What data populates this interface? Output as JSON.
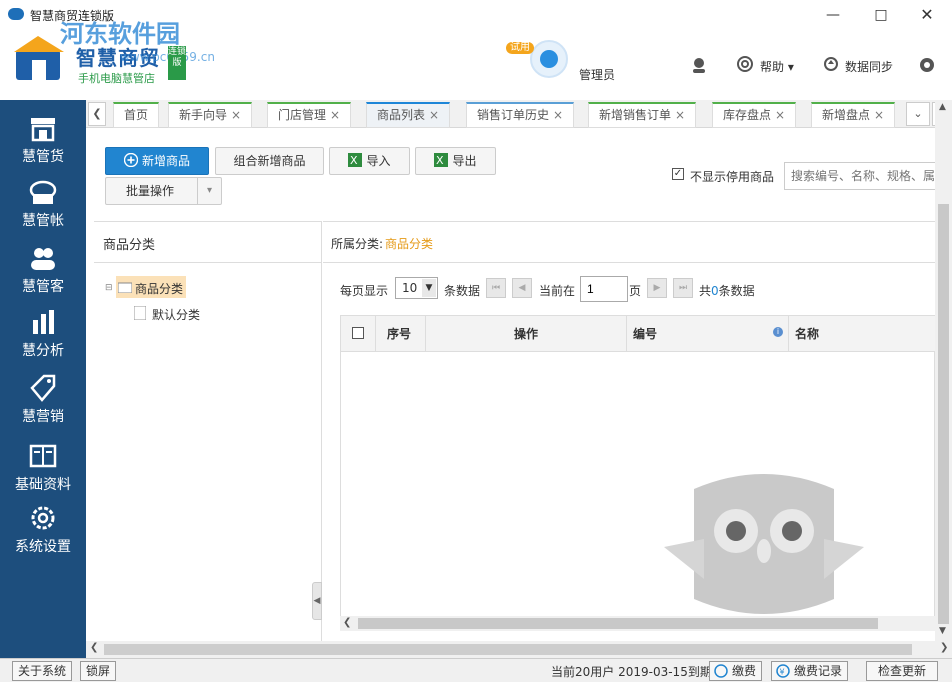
{
  "window": {
    "title": "智慧商贸连锁版"
  },
  "brand": {
    "name": "智慧商贸",
    "tagline": "手机电脑慧管店",
    "badge": "连锁版",
    "watermark": "河东软件园",
    "watermark_url": "www.pc0359.cn"
  },
  "header": {
    "trial_badge": "试用",
    "user": "管理员",
    "help": "帮助",
    "sync": "数据同步"
  },
  "sidebar": {
    "items": [
      {
        "label": "慧管货",
        "icon": "store-icon"
      },
      {
        "label": "慧管帐",
        "icon": "ledger-icon"
      },
      {
        "label": "慧管客",
        "icon": "customers-icon"
      },
      {
        "label": "慧分析",
        "icon": "bar-chart-icon"
      },
      {
        "label": "慧营销",
        "icon": "tag-icon"
      },
      {
        "label": "基础资料",
        "icon": "book-icon"
      },
      {
        "label": "系统设置",
        "icon": "gear-icon"
      }
    ]
  },
  "tabs": [
    {
      "label": "首页",
      "closable": false
    },
    {
      "label": "新手向导",
      "closable": true
    },
    {
      "label": "门店管理",
      "closable": true
    },
    {
      "label": "商品列表",
      "closable": true
    },
    {
      "label": "销售订单历史",
      "closable": true
    },
    {
      "label": "新增销售订单",
      "closable": true
    },
    {
      "label": "库存盘点",
      "closable": true
    },
    {
      "label": "新增盘点",
      "closable": true
    }
  ],
  "toolbar": {
    "add": "新增商品",
    "combo_add": "组合新增商品",
    "import": "导入",
    "export": "导出",
    "batch": "批量操作",
    "hide_disabled": "不显示停用商品",
    "search_placeholder": "搜索编号、名称、规格、属"
  },
  "category": {
    "title": "商品分类",
    "root": "商品分类",
    "child": "默认分类",
    "current_label": "所属分类:",
    "current_value": "商品分类"
  },
  "pager": {
    "per_page_label": "每页显示",
    "per_page": "10",
    "unit": "条数据",
    "current_label": "当前在",
    "current_page": "1",
    "page_unit": "页",
    "total_prefix": "共",
    "total_count": "0",
    "total_suffix": "条数据"
  },
  "grid": {
    "columns": [
      "序号",
      "操作",
      "编号",
      "名称"
    ]
  },
  "statusbar": {
    "about": "关于系统",
    "lock": "锁屏",
    "license": "当前20用户 2019-03-15到期",
    "pay": "缴费",
    "pay_records": "缴费记录",
    "update": "检查更新"
  },
  "colors": {
    "sidebar": "#1d4e7d",
    "primary": "#2185d0",
    "accent_orange": "#f4a51c",
    "category_highlight": "#e59a17"
  }
}
